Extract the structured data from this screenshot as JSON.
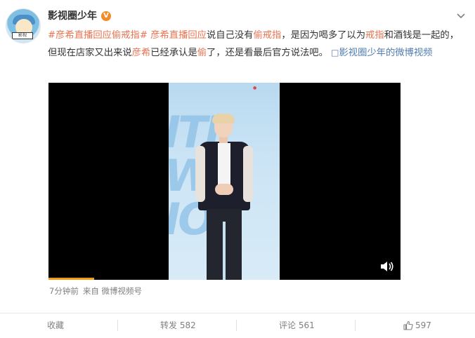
{
  "post": {
    "author": "影视圈少年",
    "verified_badge": "V",
    "text_segments": [
      {
        "text": "#彦希直播回应偷戒指#",
        "style": "link"
      },
      {
        "text": " ",
        "style": "plain"
      },
      {
        "text": "彦希直播回应",
        "style": "link"
      },
      {
        "text": "说自己没有",
        "style": "plain"
      },
      {
        "text": "偷戒指",
        "style": "link"
      },
      {
        "text": "，是因为喝多了以为",
        "style": "plain"
      },
      {
        "text": "戒指",
        "style": "link"
      },
      {
        "text": "和酒钱是一起的，但现在店家又出来说",
        "style": "plain"
      },
      {
        "text": "彦希",
        "style": "link"
      },
      {
        "text": "已经承认是",
        "style": "plain"
      },
      {
        "text": "偷",
        "style": "link"
      },
      {
        "text": "了，还是看最后官方说法吧。 ",
        "style": "plain"
      },
      {
        "text": "□",
        "style": "vicon"
      },
      {
        "text": "影视圈少年的微博视频",
        "style": "vlink"
      }
    ],
    "video": {
      "progress_fraction": 0.13,
      "volume_icon": "speaker-icon"
    },
    "meta": {
      "time": "7分钟前",
      "source_prefix": "来自",
      "source": "微博视频号"
    },
    "actions": {
      "favorite_label": "收藏",
      "repost_label": "转发",
      "repost_count": "582",
      "comment_label": "评论",
      "comment_count": "561",
      "like_count": "597"
    },
    "colors": {
      "link": "#eb7350",
      "video_link": "#507daf",
      "progress": "#f29b12",
      "verified": "#f28c28"
    }
  }
}
